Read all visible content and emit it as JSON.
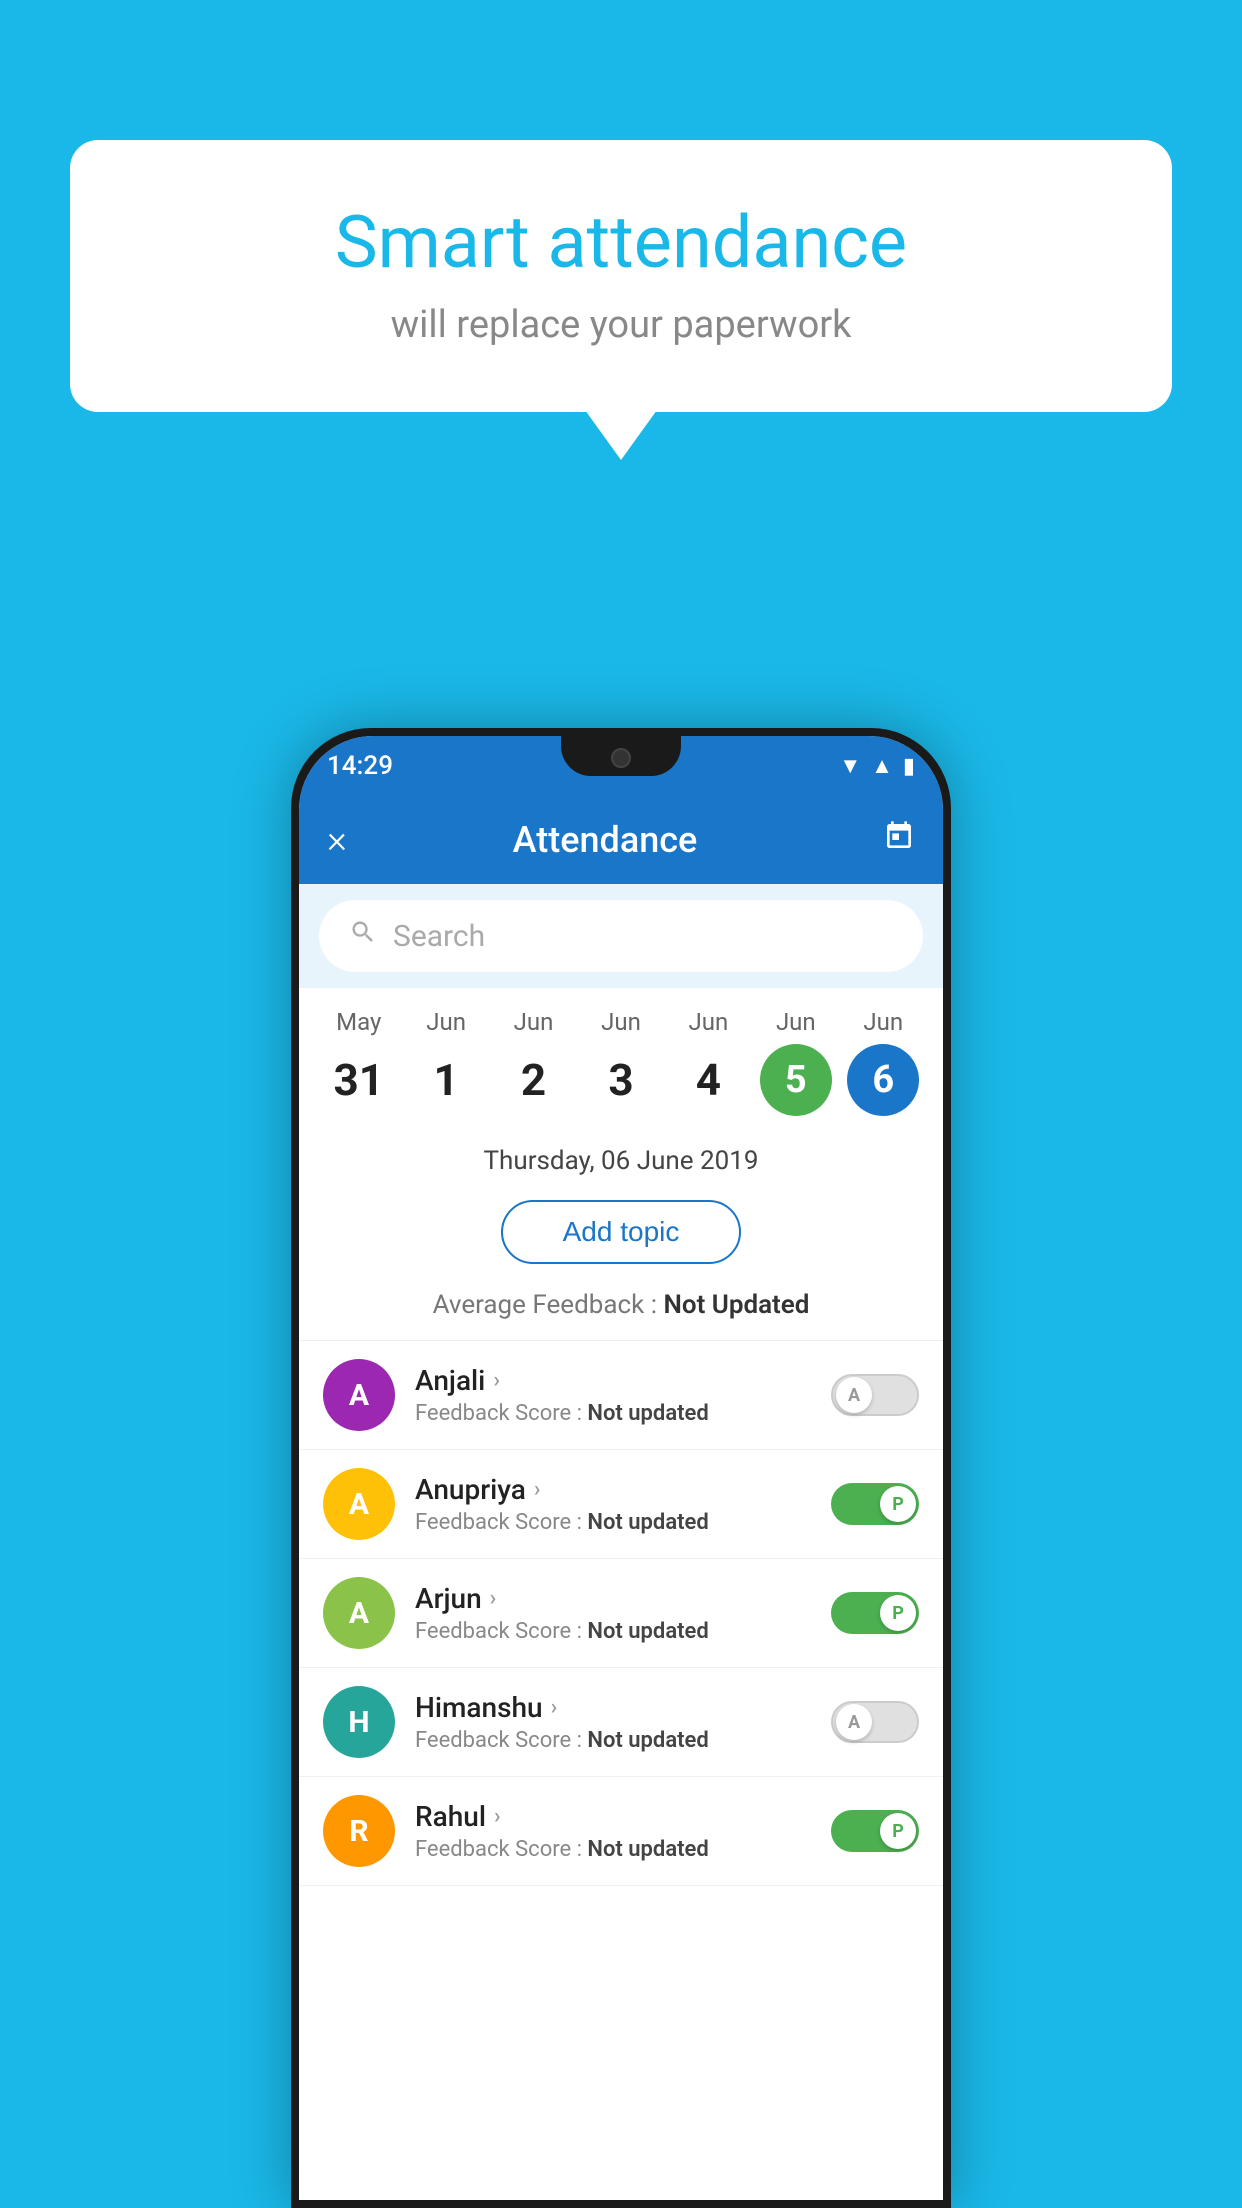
{
  "background_color": "#1ab8e8",
  "bubble": {
    "title": "Smart attendance",
    "subtitle": "will replace your paperwork"
  },
  "status_bar": {
    "time": "14:29",
    "icons": [
      "wifi",
      "signal",
      "battery"
    ]
  },
  "app_bar": {
    "close_label": "×",
    "title": "Attendance",
    "calendar_icon": "calendar"
  },
  "search": {
    "placeholder": "Search"
  },
  "dates": [
    {
      "month": "May",
      "day": "31",
      "style": "normal"
    },
    {
      "month": "Jun",
      "day": "1",
      "style": "normal"
    },
    {
      "month": "Jun",
      "day": "2",
      "style": "normal"
    },
    {
      "month": "Jun",
      "day": "3",
      "style": "normal"
    },
    {
      "month": "Jun",
      "day": "4",
      "style": "normal"
    },
    {
      "month": "Jun",
      "day": "5",
      "style": "green"
    },
    {
      "month": "Jun",
      "day": "6",
      "style": "blue"
    }
  ],
  "selected_date": "Thursday, 06 June 2019",
  "add_topic_label": "Add topic",
  "feedback_label": "Average Feedback : ",
  "feedback_value": "Not Updated",
  "students": [
    {
      "name": "Anjali",
      "avatar_letter": "A",
      "avatar_color": "purple",
      "feedback_label": "Feedback Score : ",
      "feedback_value": "Not updated",
      "toggle": "off",
      "toggle_letter": "A"
    },
    {
      "name": "Anupriya",
      "avatar_letter": "A",
      "avatar_color": "amber",
      "feedback_label": "Feedback Score : ",
      "feedback_value": "Not updated",
      "toggle": "on",
      "toggle_letter": "P"
    },
    {
      "name": "Arjun",
      "avatar_letter": "A",
      "avatar_color": "light-green",
      "feedback_label": "Feedback Score : ",
      "feedback_value": "Not updated",
      "toggle": "on",
      "toggle_letter": "P"
    },
    {
      "name": "Himanshu",
      "avatar_letter": "H",
      "avatar_color": "teal",
      "feedback_label": "Feedback Score : ",
      "feedback_value": "Not updated",
      "toggle": "off",
      "toggle_letter": "A"
    },
    {
      "name": "Rahul",
      "avatar_letter": "R",
      "avatar_color": "orange",
      "feedback_label": "Feedback Score : ",
      "feedback_value": "Not updated",
      "toggle": "on",
      "toggle_letter": "P"
    }
  ]
}
